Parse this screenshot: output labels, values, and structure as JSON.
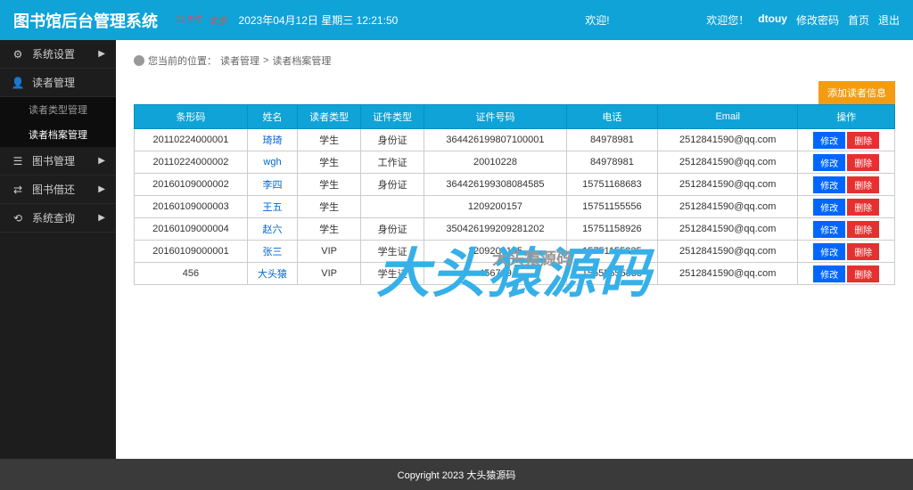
{
  "header": {
    "title": "图书馆后台管理系统",
    "weather_temp": "11-5℃",
    "weather_city": "北京",
    "datetime": "2023年04月12日 星期三 12:21:50",
    "welcome": "欢迎!",
    "welcome2": "欢迎您！",
    "username": "dtouy",
    "changepw": "修改密码",
    "home": "首页",
    "logout": "退出"
  },
  "sidebar": {
    "items": [
      {
        "label": "系统设置",
        "icon": "gear"
      },
      {
        "label": "读者管理",
        "icon": "user"
      },
      {
        "label": "图书管理",
        "icon": "book"
      },
      {
        "label": "图书借还",
        "icon": "swap"
      },
      {
        "label": "系统查询",
        "icon": "search"
      }
    ],
    "sub_reader": {
      "type_mgmt": "读者类型管理",
      "file_mgmt": "读者档案管理"
    }
  },
  "breadcrumb": {
    "label": "您当前的位置：",
    "p1": "读者管理",
    "sep": ">",
    "p2": "读者档案管理"
  },
  "buttons": {
    "add": "添加读者信息",
    "edit": "修改",
    "del": "删除"
  },
  "table": {
    "headers": [
      "条形码",
      "姓名",
      "读者类型",
      "证件类型",
      "证件号码",
      "电话",
      "Email",
      "操作"
    ],
    "rows": [
      {
        "barcode": "20110224000001",
        "name": "琦琦",
        "rtype": "学生",
        "idtype": "身份证",
        "idnum": "364426199807100001",
        "phone": "84978981",
        "email": "2512841590@qq.com"
      },
      {
        "barcode": "20110224000002",
        "name": "wgh",
        "rtype": "学生",
        "idtype": "工作证",
        "idnum": "20010228",
        "phone": "84978981",
        "email": "2512841590@qq.com"
      },
      {
        "barcode": "20160109000002",
        "name": "李四",
        "rtype": "学生",
        "idtype": "身份证",
        "idnum": "364426199308084585",
        "phone": "15751168683",
        "email": "2512841590@qq.com"
      },
      {
        "barcode": "20160109000003",
        "name": "王五",
        "rtype": "学生",
        "idtype": "",
        "idnum": "1209200157",
        "phone": "15751155556",
        "email": "2512841590@qq.com"
      },
      {
        "barcode": "20160109000004",
        "name": "赵六",
        "rtype": "学生",
        "idtype": "身份证",
        "idnum": "350426199209281202",
        "phone": "15751158926",
        "email": "2512841590@qq.com"
      },
      {
        "barcode": "20160109000001",
        "name": "张三",
        "rtype": "VIP",
        "idtype": "学生证",
        "idnum": "1209200155",
        "phone": "15751155335",
        "email": "2512841590@qq.com"
      },
      {
        "barcode": "456",
        "name": "大头猿",
        "rtype": "VIP",
        "idtype": "学生证",
        "idnum": "456789",
        "phone": "15555555555",
        "email": "2512841590@qq.com"
      }
    ]
  },
  "watermark": {
    "main": "大头猿源码",
    "sub": "大头猿源码"
  },
  "footer": "Copyright 2023 大头猿源码"
}
